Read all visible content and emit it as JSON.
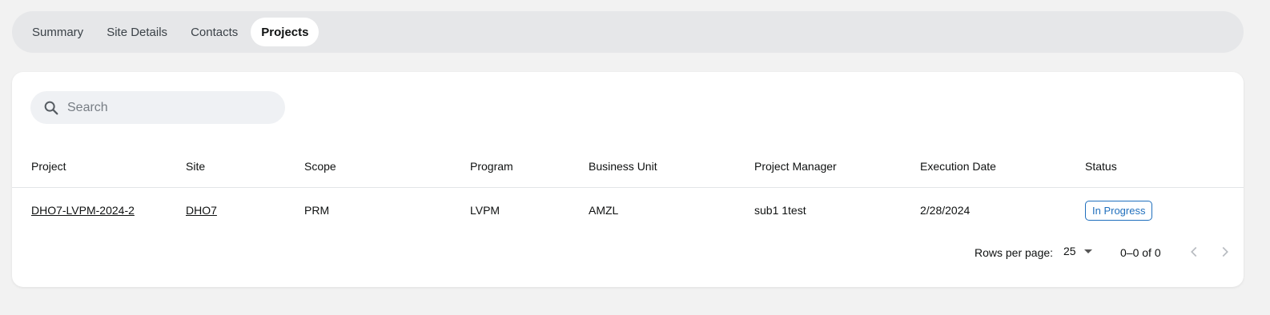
{
  "tabs": [
    {
      "label": "Summary"
    },
    {
      "label": "Site Details"
    },
    {
      "label": "Contacts"
    },
    {
      "label": "Projects",
      "active": true
    }
  ],
  "search": {
    "placeholder": "Search",
    "icon": "search-icon"
  },
  "table": {
    "columns": [
      "Project",
      "Site",
      "Scope",
      "Program",
      "Business Unit",
      "Project Manager",
      "Execution Date",
      "Status"
    ],
    "rows": [
      {
        "project": "DHO7-LVPM-2024-2",
        "site": "DHO7",
        "scope": "PRM",
        "program": "LVPM",
        "business_unit": "AMZL",
        "project_manager": "sub1 1test",
        "execution_date": "2/28/2024",
        "status": "In Progress"
      }
    ]
  },
  "pagination": {
    "rows_per_page_label": "Rows per page:",
    "rows_per_page": "25",
    "range": "0–0 of 0",
    "prev_icon": "chevron-left-icon",
    "next_icon": "chevron-right-icon"
  },
  "colors": {
    "tabbar_bg": "#e6e7e9",
    "status_accent": "#1f6fbd",
    "page_bg": "#f2f2f2"
  }
}
